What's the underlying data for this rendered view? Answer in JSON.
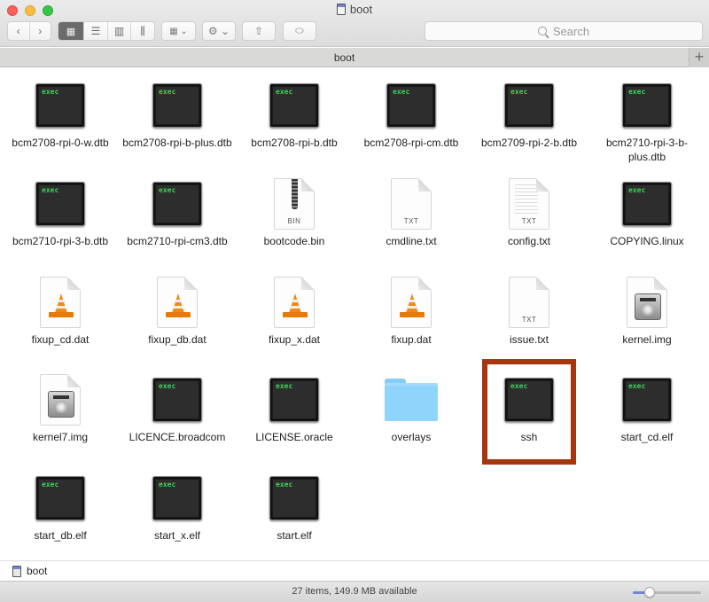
{
  "window": {
    "title": "boot",
    "traffic_lights": [
      "close",
      "minimize",
      "maximize"
    ]
  },
  "toolbar": {
    "back_icon": "chevron-left-icon",
    "forward_icon": "chevron-right-icon",
    "view_modes": [
      {
        "name": "icon-view",
        "glyph": "▦",
        "active": true
      },
      {
        "name": "list-view",
        "glyph": "☰",
        "active": false
      },
      {
        "name": "column-view",
        "glyph": "▥",
        "active": false
      },
      {
        "name": "cover-flow-view",
        "glyph": "⫼",
        "active": false
      }
    ],
    "group_glyph": "▦ ⌄",
    "action_glyph": "⚙ ⌄",
    "share_glyph": "⇧",
    "tag_glyph": "⬭",
    "search_placeholder": "Search"
  },
  "tabbar": {
    "tab_label": "boot",
    "add_label": "+"
  },
  "files": [
    {
      "name": "bcm2708-rpi-0-w.dtb",
      "kind": "exec"
    },
    {
      "name": "bcm2708-rpi-b-plus.dtb",
      "kind": "exec"
    },
    {
      "name": "bcm2708-rpi-b.dtb",
      "kind": "exec"
    },
    {
      "name": "bcm2708-rpi-cm.dtb",
      "kind": "exec"
    },
    {
      "name": "bcm2709-rpi-2-b.dtb",
      "kind": "exec"
    },
    {
      "name": "bcm2710-rpi-3-b-plus.dtb",
      "kind": "exec"
    },
    {
      "name": "bcm2710-rpi-3-b.dtb",
      "kind": "exec"
    },
    {
      "name": "bcm2710-rpi-cm3.dtb",
      "kind": "exec"
    },
    {
      "name": "bootcode.bin",
      "kind": "bin",
      "tag": "BIN"
    },
    {
      "name": "cmdline.txt",
      "kind": "txt",
      "tag": "TXT"
    },
    {
      "name": "config.txt",
      "kind": "txt-lines",
      "tag": "TXT"
    },
    {
      "name": "COPYING.linux",
      "kind": "exec"
    },
    {
      "name": "fixup_cd.dat",
      "kind": "vlc"
    },
    {
      "name": "fixup_db.dat",
      "kind": "vlc"
    },
    {
      "name": "fixup_x.dat",
      "kind": "vlc"
    },
    {
      "name": "fixup.dat",
      "kind": "vlc"
    },
    {
      "name": "issue.txt",
      "kind": "txt",
      "tag": "TXT"
    },
    {
      "name": "kernel.img",
      "kind": "img"
    },
    {
      "name": "kernel7.img",
      "kind": "img"
    },
    {
      "name": "LICENCE.broadcom",
      "kind": "exec"
    },
    {
      "name": "LICENSE.oracle",
      "kind": "exec"
    },
    {
      "name": "overlays",
      "kind": "folder"
    },
    {
      "name": "ssh",
      "kind": "exec",
      "highlighted": true
    },
    {
      "name": "start_cd.elf",
      "kind": "exec"
    },
    {
      "name": "start_db.elf",
      "kind": "exec"
    },
    {
      "name": "start_x.elf",
      "kind": "exec"
    },
    {
      "name": "start.elf",
      "kind": "exec"
    }
  ],
  "exec_label": "exec",
  "highlight_color": "#a5360e",
  "pathbar": {
    "items": [
      "boot"
    ]
  },
  "statusbar": {
    "text": "27 items, 149.9 MB available",
    "icon_size_slider": 0.25
  }
}
